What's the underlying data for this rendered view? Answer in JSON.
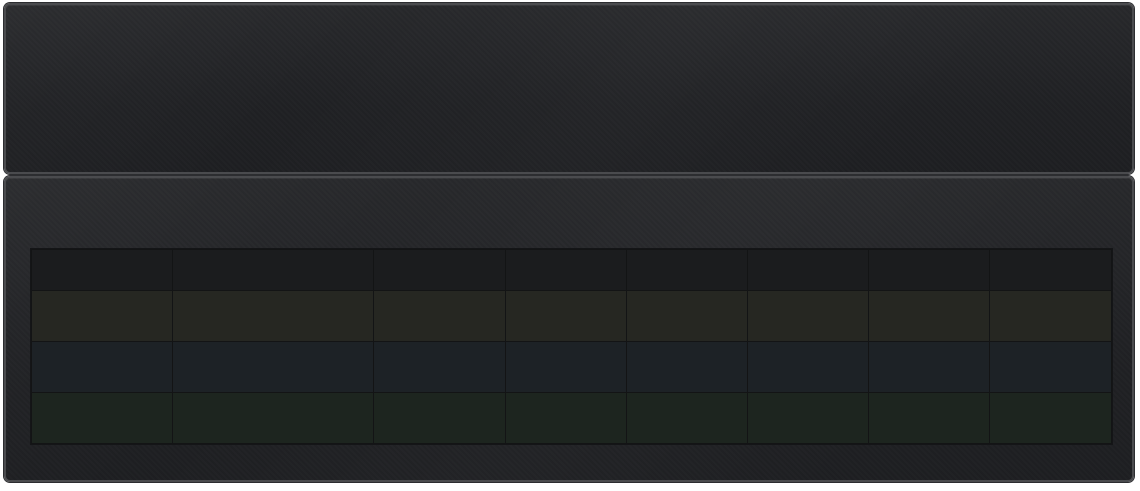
{
  "layout": {
    "panels": [
      {
        "id": "top",
        "content": ""
      },
      {
        "id": "bottom",
        "content": ""
      }
    ]
  },
  "grid": {
    "columns": [
      "",
      "",
      "",
      "",
      "",
      "",
      "",
      ""
    ],
    "rows": [
      {
        "kind": "header",
        "cells": [
          "",
          "",
          "",
          "",
          "",
          "",
          "",
          ""
        ]
      },
      {
        "kind": "row-a",
        "color": "#262722",
        "cells": [
          "",
          "",
          "",
          "",
          "",
          "",
          "",
          ""
        ]
      },
      {
        "kind": "row-b",
        "color": "#1d2226",
        "cells": [
          "",
          "",
          "",
          "",
          "",
          "",
          "",
          ""
        ]
      },
      {
        "kind": "row-c",
        "color": "#1d251f",
        "cells": [
          "",
          "",
          "",
          "",
          "",
          "",
          "",
          ""
        ]
      }
    ]
  },
  "colors": {
    "panel_background": "#222326",
    "panel_border": "#4a4b4e",
    "grid_background": "#1b1c1e",
    "grid_lines": "#131415"
  }
}
